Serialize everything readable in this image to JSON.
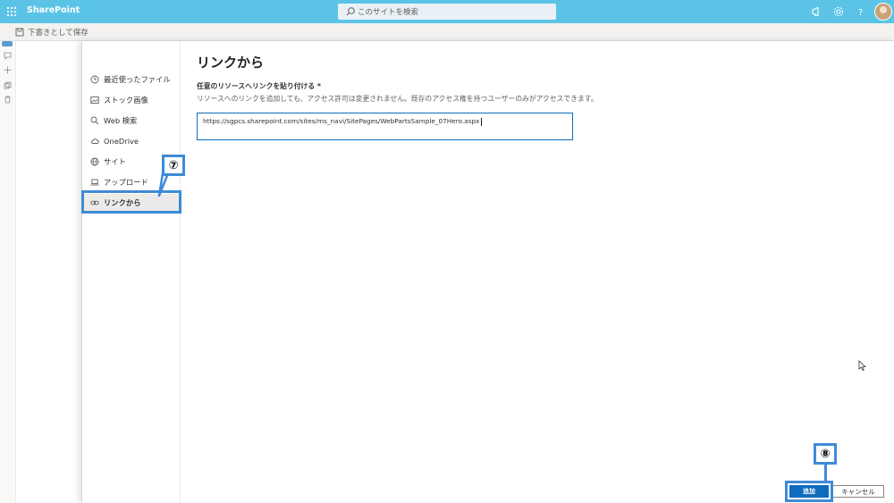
{
  "suitebar": {
    "brand": "SharePoint",
    "search_placeholder": "このサイトを検索"
  },
  "commandbar": {
    "save_draft_label": "下書きとして保存"
  },
  "panel": {
    "nav": [
      {
        "label": "最近使ったファイル",
        "icon": "clock-icon"
      },
      {
        "label": "ストック画像",
        "icon": "image-icon"
      },
      {
        "label": "Web 検索",
        "icon": "search-icon"
      },
      {
        "label": "OneDrive",
        "icon": "cloud-icon"
      },
      {
        "label": "サイト",
        "icon": "globe-icon"
      },
      {
        "label": "アップロード",
        "icon": "laptop-icon"
      },
      {
        "label": "リンクから",
        "icon": "link-icon",
        "selected": true
      }
    ],
    "title": "リンクから",
    "field_label": "任意のリソースへリンクを貼り付ける *",
    "field_help": "リソースへのリンクを追加しても、アクセス許可は変更されません。既存のアクセス権を持つユーザーのみがアクセスできます。",
    "url_value": "https://sgpcs.sharepoint.com/sites/ms_navi/SitePages/WebPartsSample_07Hero.aspx"
  },
  "footer": {
    "add_label": "追加",
    "cancel_label": "キャンセル"
  },
  "annotations": {
    "step7": "⑦",
    "step8": "⑧"
  },
  "colors": {
    "suitebar": "#5bc4e6",
    "accent": "#0f6cbd",
    "annotation": "#3e8bd6"
  }
}
